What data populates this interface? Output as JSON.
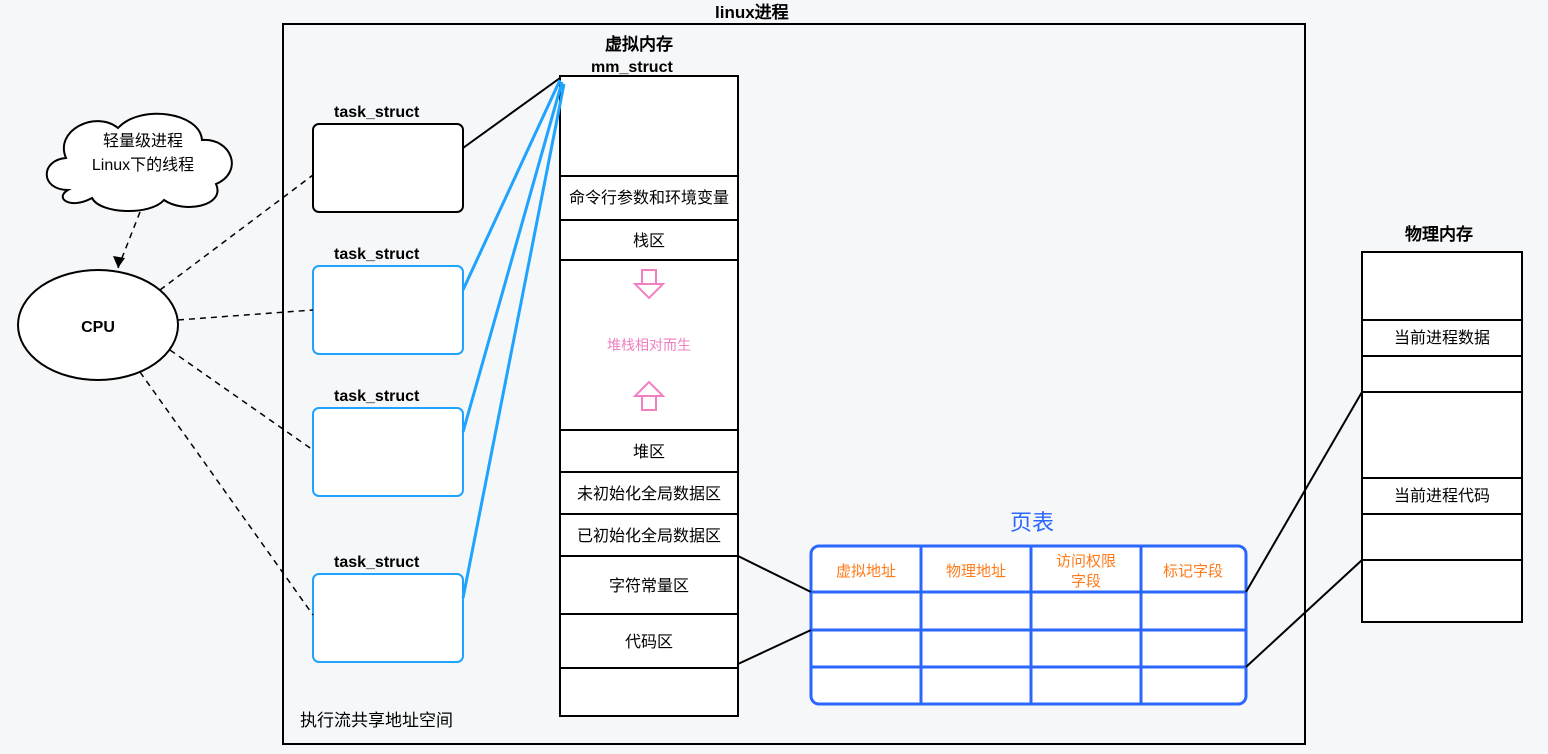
{
  "titles": {
    "linux_process": "linux进程",
    "virtual_memory": "虚拟内存",
    "mm_struct": "mm_struct",
    "physical_memory": "物理内存",
    "page_table": "页表",
    "cpu": "CPU",
    "footer": "执行流共享地址空间"
  },
  "cloud": {
    "line1": "轻量级进程",
    "line2": "Linux下的线程"
  },
  "task_struct_label": "task_struct",
  "memory_segments": {
    "args_env": "命令行参数和环境变量",
    "stack": "栈区",
    "heap_stack_note": "堆栈相对而生",
    "heap": "堆区",
    "bss": "未初始化全局数据区",
    "data": "已初始化全局数据区",
    "rodata": "字符常量区",
    "text": "代码区"
  },
  "page_table_headers": {
    "vaddr": "虚拟地址",
    "paddr": "物理地址",
    "perm1": "访问权限",
    "perm2": "字段",
    "flag": "标记字段"
  },
  "phys_mem": {
    "data": "当前进程数据",
    "code": "当前进程代码"
  }
}
